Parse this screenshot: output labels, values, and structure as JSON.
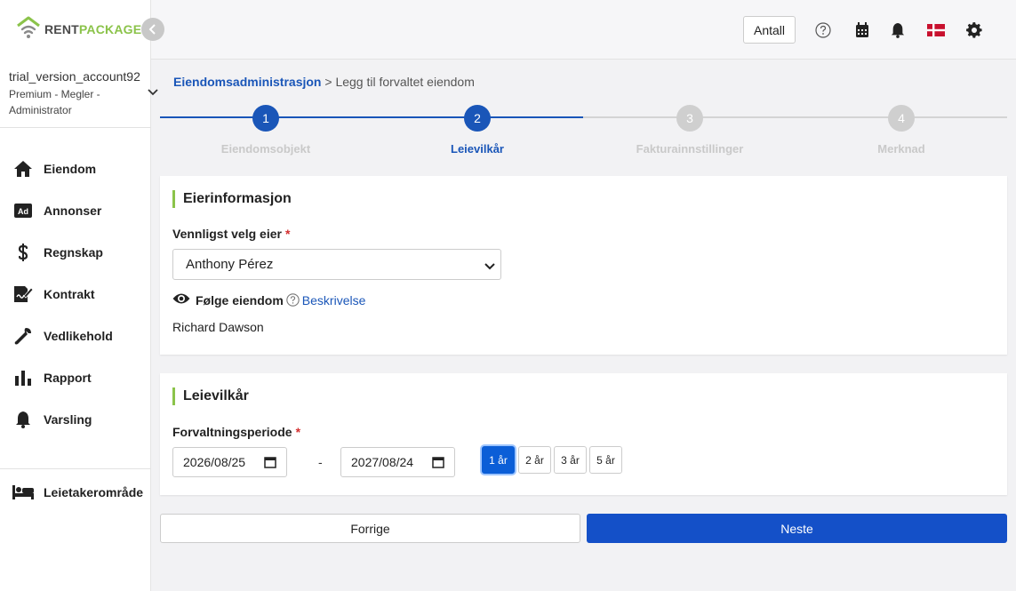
{
  "app": {
    "logo_rent": "RENT",
    "logo_package": "PACKAGE"
  },
  "account": {
    "name": "trial_version_account92",
    "role": "Premium - Megler - Administrator"
  },
  "sidebar": {
    "items": [
      {
        "label": "Eiendom",
        "icon": "home-icon"
      },
      {
        "label": "Annonser",
        "icon": "ad-icon"
      },
      {
        "label": "Regnskap",
        "icon": "dollar-icon"
      },
      {
        "label": "Kontrakt",
        "icon": "contract-icon"
      },
      {
        "label": "Vedlikehold",
        "icon": "wrench-icon"
      },
      {
        "label": "Rapport",
        "icon": "bar-chart-icon"
      },
      {
        "label": "Varsling",
        "icon": "bell-icon"
      }
    ],
    "tenant_area": {
      "label": "Leietakerområde",
      "icon": "bed-icon"
    }
  },
  "topbar": {
    "antall_label": "Antall",
    "icons": [
      "help-icon",
      "calendar-icon",
      "bell-icon",
      "flag-icon",
      "gear-icon"
    ]
  },
  "breadcrumb": {
    "parent": "Eiendomsadministrasjon",
    "separator": ">",
    "current": "Legg til forvaltet eiendom"
  },
  "stepper": {
    "steps": [
      {
        "number": "1",
        "label": "Eiendomsobjekt",
        "state": "done"
      },
      {
        "number": "2",
        "label": "Leievilkår",
        "state": "active"
      },
      {
        "number": "3",
        "label": "Fakturainnstillinger",
        "state": "pending"
      },
      {
        "number": "4",
        "label": "Merknad",
        "state": "pending"
      }
    ]
  },
  "owner_card": {
    "title": "Eierinformasjon",
    "owner_label": "Vennligst velg eier",
    "required_mark": "*",
    "owner_value": "Anthony Pérez",
    "follow_label": "Følge eiendom",
    "description_link": "Beskrivelse",
    "follower_name": "Richard Dawson"
  },
  "terms_card": {
    "title": "Leievilkår",
    "period_label": "Forvaltningsperiode",
    "required_mark": "*",
    "start_date": "2026/08/25",
    "dash": "-",
    "end_date": "2027/08/24",
    "year_options": [
      "1 år",
      "2 år",
      "3 år",
      "5 år"
    ],
    "selected_year": "1 år"
  },
  "footer": {
    "prev_label": "Forrige",
    "next_label": "Neste"
  },
  "colors": {
    "primary": "#1450c8",
    "step_active": "#1a56b8",
    "step_pending": "#cfcfcf",
    "accent_green": "#8bc34a"
  }
}
